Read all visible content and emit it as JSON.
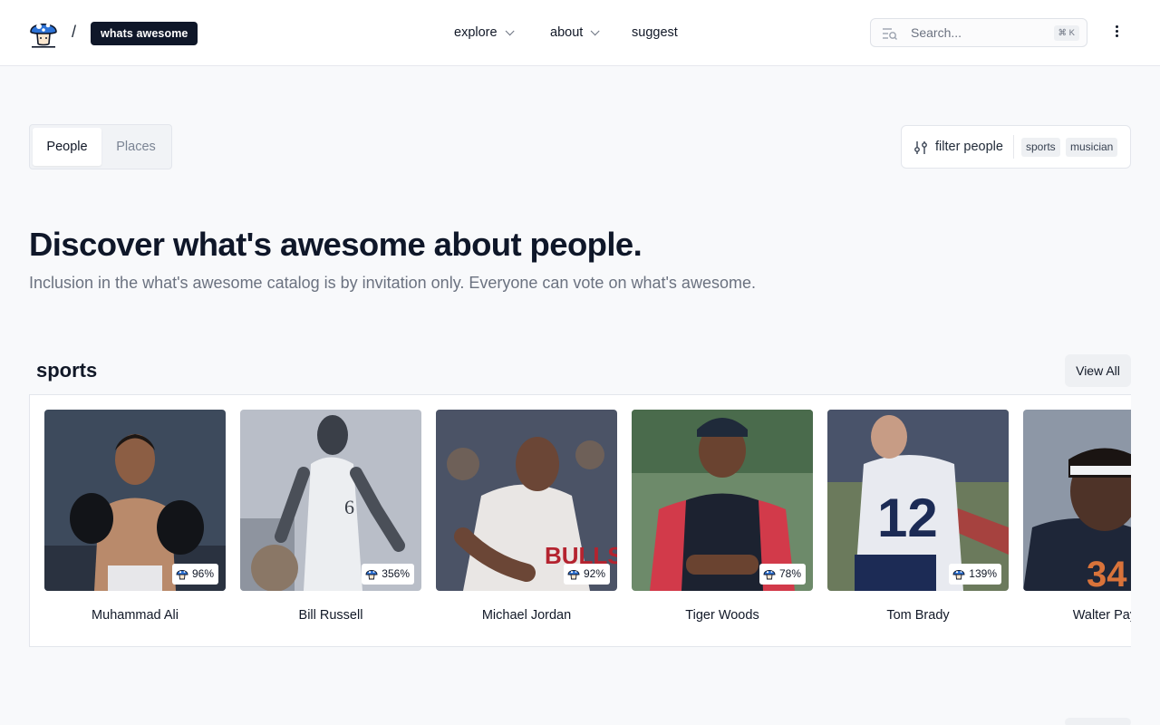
{
  "header": {
    "brand_label": "whats awesome",
    "separator": "/",
    "nav": [
      {
        "label": "explore",
        "has_menu": true
      },
      {
        "label": "about",
        "has_menu": true
      },
      {
        "label": "suggest",
        "has_menu": false
      }
    ],
    "search": {
      "placeholder": "Search...",
      "shortcut": "⌘ K",
      "icon": "search-list-icon"
    },
    "menu_icon": "more-vertical-icon",
    "logo_icon": "mushroom-logo-icon"
  },
  "tabs": [
    {
      "label": "People",
      "active": true
    },
    {
      "label": "Places",
      "active": false
    }
  ],
  "filter": {
    "label": "filter people",
    "icon": "sliders-icon",
    "chips": [
      "sports",
      "musician"
    ]
  },
  "hero": {
    "title": "Discover what's awesome about people.",
    "subtitle": "Inclusion in the what's awesome catalog is by invitation only. Everyone can vote on what's awesome."
  },
  "section": {
    "title": "sports",
    "view_all_label": "View All",
    "cards": [
      {
        "name": "Muhammad Ali",
        "percent": "96%"
      },
      {
        "name": "Bill Russell",
        "percent": "356%"
      },
      {
        "name": "Michael Jordan",
        "percent": "92%"
      },
      {
        "name": "Tiger Woods",
        "percent": "78%"
      },
      {
        "name": "Tom Brady",
        "percent": "139%"
      },
      {
        "name": "Walter Payton",
        "percent": ""
      }
    ]
  },
  "colors": {
    "accent_dark": "#0f1729",
    "page_bg": "#f8f9fb",
    "muted_text": "#6b7280"
  }
}
